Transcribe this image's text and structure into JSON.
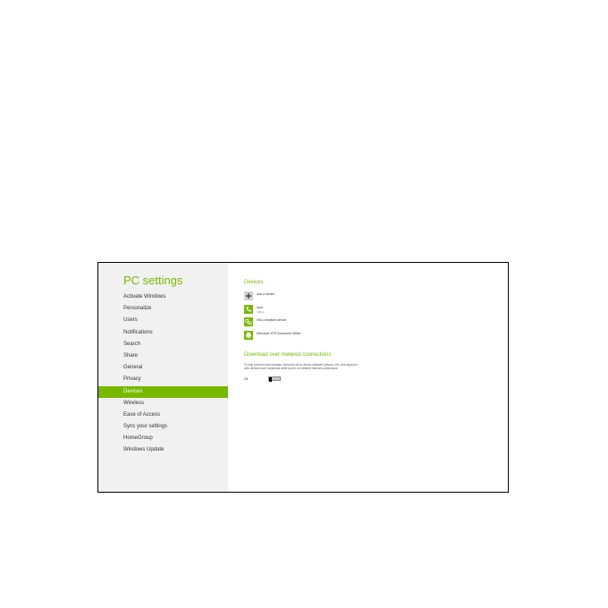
{
  "app": {
    "title": "PC settings"
  },
  "nav": {
    "items": [
      {
        "label": "Activate Windows"
      },
      {
        "label": "Personalize"
      },
      {
        "label": "Users"
      },
      {
        "label": "Notifications"
      },
      {
        "label": "Search"
      },
      {
        "label": "Share"
      },
      {
        "label": "General"
      },
      {
        "label": "Privacy"
      },
      {
        "label": "Devices",
        "selected": true
      },
      {
        "label": "Wireless"
      },
      {
        "label": "Ease of Access"
      },
      {
        "label": "Sync your settings"
      },
      {
        "label": "HomeGroup"
      },
      {
        "label": "Windows Update"
      }
    ]
  },
  "devices": {
    "title": "Devices",
    "items": [
      {
        "name": "Add a device",
        "status": "",
        "icon": "plus-icon"
      },
      {
        "name": "Acer",
        "status": "Offline",
        "icon": "phone-icon"
      },
      {
        "name": "HID-compliant device",
        "status": "",
        "icon": "network-device-icon"
      },
      {
        "name": "Microsoft XPS Document Writer",
        "status": "",
        "icon": "printer-icon"
      }
    ]
  },
  "metered": {
    "title": "Download over metered connections",
    "description": "To help prevent extra charges, keep this off so device software (drivers, info, and apps) for new devices won't download while you're on metered Internet connections.",
    "toggle_state": "Off"
  },
  "colors": {
    "accent": "#77b900",
    "sidebar_bg": "#f1f1f1"
  }
}
